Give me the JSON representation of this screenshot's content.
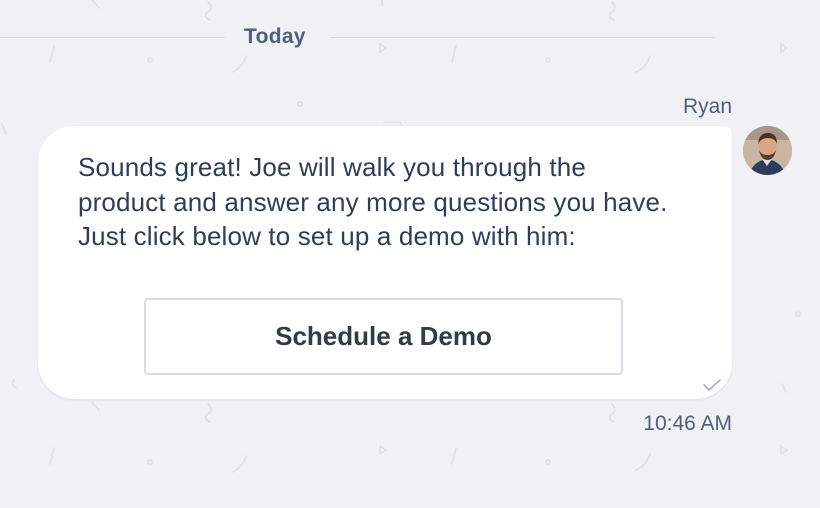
{
  "conversation": {
    "day_label": "Today",
    "message": {
      "sender": "Ryan",
      "avatar_icon": "person-avatar",
      "text": "Sounds great! Joe will walk you through the product and answer any more questions you have. Just click below to set up a demo with him:",
      "button_label": "Schedule a Demo",
      "status_icon": "checkmark-icon",
      "time": "10:46 AM"
    }
  },
  "colors": {
    "background": "#eff1f5",
    "bubble": "#ffffff",
    "text": "#2d3e5a",
    "meta_text": "#4f6078"
  }
}
